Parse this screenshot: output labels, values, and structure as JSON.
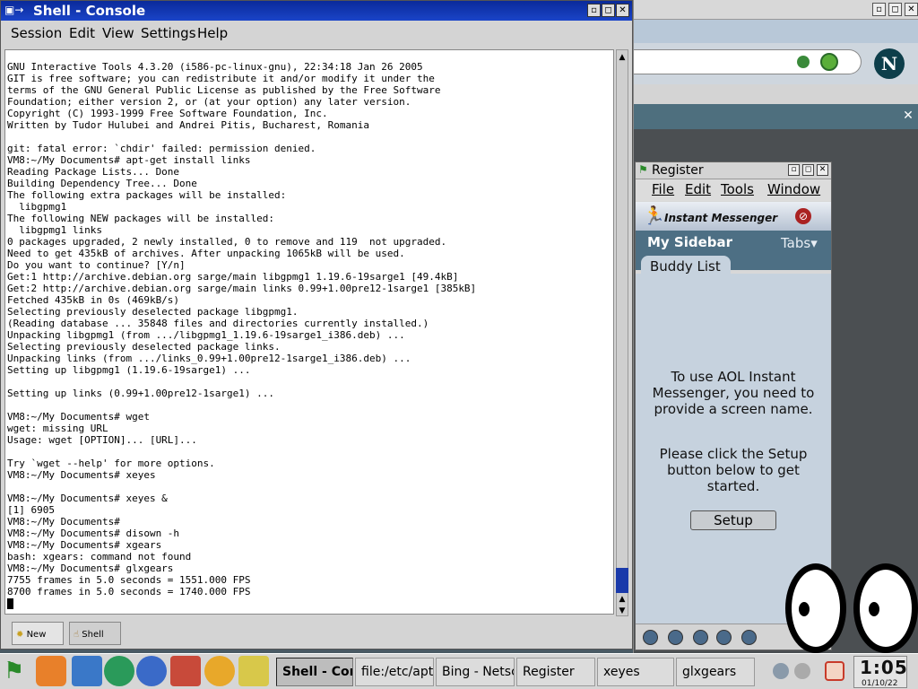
{
  "console": {
    "title": "Shell - Console",
    "menu": [
      "Session",
      "Edit",
      "View",
      "Settings",
      "Help"
    ],
    "lines": [
      "GNU Interactive Tools 4.3.20 (i586-pc-linux-gnu), 22:34:18 Jan 26 2005",
      "GIT is free software; you can redistribute it and/or modify it under the",
      "terms of the GNU General Public License as published by the Free Software",
      "Foundation; either version 2, or (at your option) any later version.",
      "Copyright (C) 1993-1999 Free Software Foundation, Inc.",
      "Written by Tudor Hulubei and Andrei Pitis, Bucharest, Romania",
      "",
      "git: fatal error: `chdir' failed: permission denied.",
      "VM8:~/My Documents# apt-get install links",
      "Reading Package Lists... Done",
      "Building Dependency Tree... Done",
      "The following extra packages will be installed:",
      "  libgpmg1",
      "The following NEW packages will be installed:",
      "  libgpmg1 links",
      "0 packages upgraded, 2 newly installed, 0 to remove and 119  not upgraded.",
      "Need to get 435kB of archives. After unpacking 1065kB will be used.",
      "Do you want to continue? [Y/n]",
      "Get:1 http://archive.debian.org sarge/main libgpmg1 1.19.6-19sarge1 [49.4kB]",
      "Get:2 http://archive.debian.org sarge/main links 0.99+1.00pre12-1sarge1 [385kB]",
      "Fetched 435kB in 0s (469kB/s)",
      "Selecting previously deselected package libgpmg1.",
      "(Reading database ... 35848 files and directories currently installed.)",
      "Unpacking libgpmg1 (from .../libgpmg1_1.19.6-19sarge1_i386.deb) ...",
      "Selecting previously deselected package links.",
      "Unpacking links (from .../links_0.99+1.00pre12-1sarge1_i386.deb) ...",
      "Setting up libgpmg1 (1.19.6-19sarge1) ...",
      "",
      "Setting up links (0.99+1.00pre12-1sarge1) ...",
      "",
      "VM8:~/My Documents# wget",
      "wget: missing URL",
      "Usage: wget [OPTION]... [URL]...",
      "",
      "Try `wget --help' for more options.",
      "VM8:~/My Documents# xeyes",
      "",
      "VM8:~/My Documents# xeyes &",
      "[1] 6905",
      "VM8:~/My Documents#",
      "VM8:~/My Documents# disown -h",
      "VM8:~/My Documents# xgears",
      "bash: xgears: command not found",
      "VM8:~/My Documents# glxgears",
      "7755 frames in 5.0 seconds = 1551.000 FPS",
      "8700 frames in 5.0 seconds = 1740.000 FPS"
    ],
    "tabs": [
      "New",
      "Shell"
    ]
  },
  "aim": {
    "title": "Register",
    "menu": [
      "File",
      "Edit",
      "Tools",
      "Window"
    ],
    "brand": "Instant Messenger",
    "sidebar_title": "My Sidebar",
    "tabs_label": "Tabs",
    "buddy_tab": "Buddy List",
    "message1": "To use AOL Instant Messenger, you need to provide a screen name.",
    "message2": "Please click the Setup button below to get started.",
    "setup_label": "Setup"
  },
  "browser": {
    "logo": "N"
  },
  "taskbar": {
    "tasks": [
      "Shell - Console",
      "file:/etc/apt",
      "Bing - Netscape",
      "Register",
      "xeyes",
      "glxgears"
    ],
    "clock_time": "1:05",
    "clock_date": "01/10/22"
  },
  "colors": {
    "titlebar": "#1a44c8",
    "aim_header": "#4d6f84",
    "aim_body": "#c6d2de"
  }
}
